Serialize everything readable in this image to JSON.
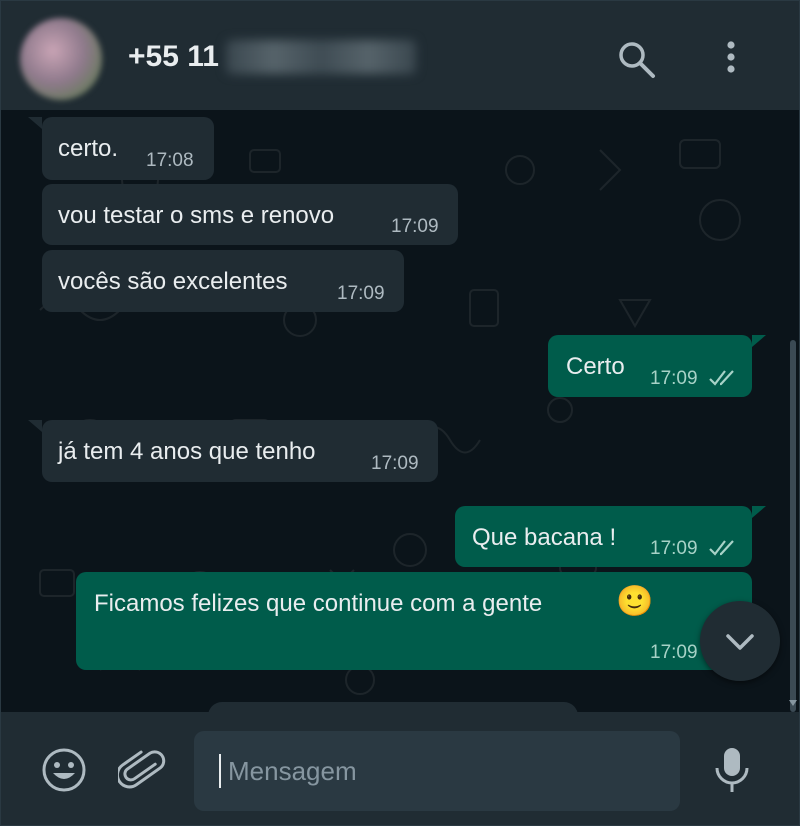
{
  "header": {
    "contact_name": "+55 11",
    "avatar_icon": "avatar-photo",
    "search_icon": "search-icon",
    "menu_icon": "more-vertical-icon"
  },
  "messages": [
    {
      "direction": "in",
      "text": "certo.",
      "time": "17:08"
    },
    {
      "direction": "in",
      "text": "vou testar o sms e renovo",
      "time": "17:09"
    },
    {
      "direction": "in",
      "text": "vocês são excelentes",
      "time": "17:09"
    },
    {
      "direction": "out",
      "text": "Certo",
      "time": "17:09",
      "status": "read"
    },
    {
      "direction": "in",
      "text": "já tem 4 anos que tenho",
      "time": "17:09"
    },
    {
      "direction": "out",
      "text": "Que bacana !",
      "time": "17:09",
      "status": "read"
    },
    {
      "direction": "out",
      "text": "Ficamos felizes que continue com a gente",
      "emoji": "🙂",
      "time": "17:09",
      "status": "read"
    }
  ],
  "composer": {
    "placeholder": "Mensagem",
    "value": "",
    "emoji_icon": "emoji-icon",
    "attach_icon": "paperclip-icon",
    "mic_icon": "microphone-icon"
  },
  "colors": {
    "header_bg": "#202c33",
    "chat_bg": "#0b141a",
    "incoming_bubble": "#202c33",
    "outgoing_bubble": "#005c4b",
    "read_ticks": "#a7d2c7",
    "icon_color": "#aebac1"
  }
}
